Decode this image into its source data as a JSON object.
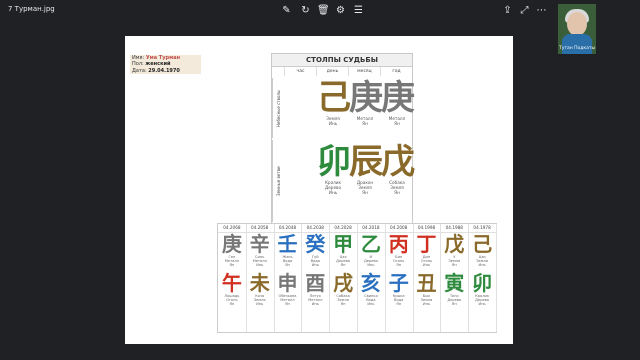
{
  "window": {
    "title": "7 Турман.jpg"
  },
  "toolbar": {
    "icons": [
      "edit-icon",
      "rotate-icon",
      "delete-icon",
      "settings-icon",
      "filter-icon"
    ]
  },
  "right_toolbar": {
    "icons": [
      "share-icon",
      "expand-icon",
      "more-icon"
    ]
  },
  "video": {
    "name": "Тутан Подкаты"
  },
  "person": {
    "name_label": "Имя:",
    "name": "Ума Турман",
    "gender_label": "Пол:",
    "gender": "женский",
    "date_label": "Дата:",
    "date": "29.04.1970"
  },
  "pillars": {
    "title": "СТОЛПЫ СУДЬБЫ",
    "headers": [
      "час",
      "день",
      "месяц",
      "год"
    ],
    "side_heaven": "Небесные стволы",
    "side_earth": "Земные ветви",
    "heaven": [
      {
        "glyph": "己",
        "color": "#8a6a2a",
        "l1": "Земля",
        "l2": "Инь"
      },
      {
        "glyph": "庚",
        "color": "#777777",
        "l1": "Металл",
        "l2": "Ян"
      },
      {
        "glyph": "庚",
        "color": "#777777",
        "l1": "Металл",
        "l2": "Ян"
      }
    ],
    "earth": [
      {
        "glyph": "卯",
        "color": "#2e8b3e",
        "l1": "Кролик",
        "l2": "",
        "l3": "Дерево",
        "l4": "Инь"
      },
      {
        "glyph": "辰",
        "color": "#8a6a2a",
        "l1": "Дракон",
        "l2": "",
        "l3": "Земля",
        "l4": "Ян"
      },
      {
        "glyph": "戊",
        "color": "#8a6a2a",
        "l1": "Собака",
        "l2": "",
        "l3": "Земля",
        "l4": "Ян"
      }
    ]
  },
  "luck": [
    {
      "date": "04.2068",
      "top": "庚",
      "tc": "#777777",
      "tl": [
        "Ген",
        "Металл",
        "Ян"
      ],
      "bot": "午",
      "bc": "#d03020",
      "bl": [
        "Лошадь",
        "Огонь",
        "Ян"
      ]
    },
    {
      "date": "04.2058",
      "top": "辛",
      "tc": "#777777",
      "tl": [
        "Синь",
        "Металл",
        "Инь"
      ],
      "bot": "未",
      "bc": "#8a6a2a",
      "bl": [
        "Коза",
        "Земля",
        "Инь"
      ]
    },
    {
      "date": "04.2048",
      "top": "壬",
      "tc": "#2a70c0",
      "tl": [
        "Жэнь",
        "Вода",
        "Ян"
      ],
      "bot": "申",
      "bc": "#777777",
      "bl": [
        "Обезьяна",
        "Металл",
        "Ян"
      ]
    },
    {
      "date": "04.2038",
      "top": "癸",
      "tc": "#2a70c0",
      "tl": [
        "Гуй",
        "Вода",
        "Инь"
      ],
      "bot": "酉",
      "bc": "#777777",
      "bl": [
        "Петух",
        "Металл",
        "Инь"
      ]
    },
    {
      "date": "04.2028",
      "top": "甲",
      "tc": "#2e8b3e",
      "tl": [
        "Цзя",
        "Дерево",
        "Ян"
      ],
      "bot": "戌",
      "bc": "#8a6a2a",
      "bl": [
        "Собака",
        "Земля",
        "Ян"
      ]
    },
    {
      "date": "04.2018",
      "top": "乙",
      "tc": "#2e8b3e",
      "tl": [
        "И",
        "Дерево",
        "Инь"
      ],
      "bot": "亥",
      "bc": "#2a70c0",
      "bl": [
        "Свинья",
        "Вода",
        "Инь"
      ]
    },
    {
      "date": "04.2008",
      "top": "丙",
      "tc": "#d03020",
      "tl": [
        "Бин",
        "Огонь",
        "Ян"
      ],
      "bot": "子",
      "bc": "#2a70c0",
      "bl": [
        "Крыса",
        "Вода",
        "Ян"
      ]
    },
    {
      "date": "04.1998",
      "top": "丁",
      "tc": "#d03020",
      "tl": [
        "Дин",
        "Огонь",
        "Инь"
      ],
      "bot": "丑",
      "bc": "#8a6a2a",
      "bl": [
        "Бык",
        "Земля",
        "Инь"
      ]
    },
    {
      "date": "04.1988",
      "top": "戊",
      "tc": "#8a6a2a",
      "tl": [
        "У",
        "Земля",
        "Ян"
      ],
      "bot": "寅",
      "bc": "#2e8b3e",
      "bl": [
        "Тигр",
        "Дерево",
        "Ян"
      ]
    },
    {
      "date": "04.1978",
      "top": "己",
      "tc": "#8a6a2a",
      "tl": [
        "Цзи",
        "Земля",
        "Инь"
      ],
      "bot": "卯",
      "bc": "#2e8b3e",
      "bl": [
        "Кролик",
        "Дерево",
        "Инь"
      ]
    }
  ]
}
